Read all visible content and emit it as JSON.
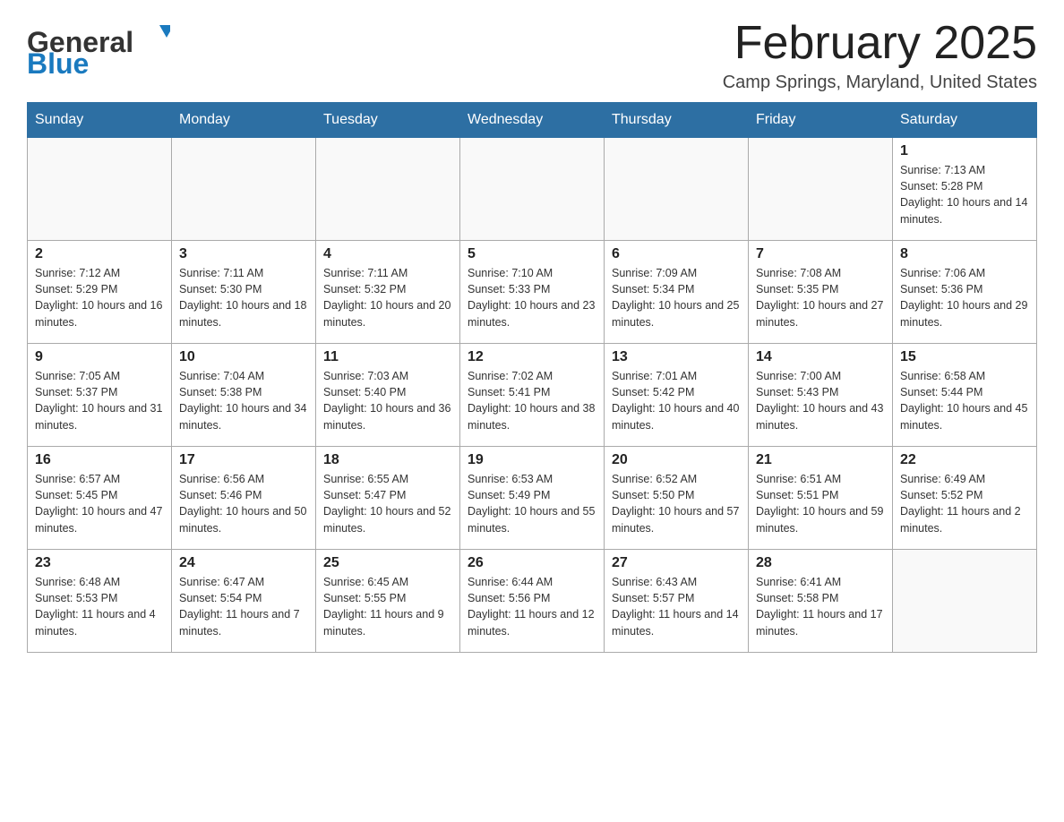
{
  "header": {
    "logo_general": "General",
    "logo_blue": "Blue",
    "month": "February 2025",
    "location": "Camp Springs, Maryland, United States"
  },
  "weekdays": [
    "Sunday",
    "Monday",
    "Tuesday",
    "Wednesday",
    "Thursday",
    "Friday",
    "Saturday"
  ],
  "weeks": [
    [
      {
        "day": "",
        "sunrise": "",
        "sunset": "",
        "daylight": ""
      },
      {
        "day": "",
        "sunrise": "",
        "sunset": "",
        "daylight": ""
      },
      {
        "day": "",
        "sunrise": "",
        "sunset": "",
        "daylight": ""
      },
      {
        "day": "",
        "sunrise": "",
        "sunset": "",
        "daylight": ""
      },
      {
        "day": "",
        "sunrise": "",
        "sunset": "",
        "daylight": ""
      },
      {
        "day": "",
        "sunrise": "",
        "sunset": "",
        "daylight": ""
      },
      {
        "day": "1",
        "sunrise": "Sunrise: 7:13 AM",
        "sunset": "Sunset: 5:28 PM",
        "daylight": "Daylight: 10 hours and 14 minutes."
      }
    ],
    [
      {
        "day": "2",
        "sunrise": "Sunrise: 7:12 AM",
        "sunset": "Sunset: 5:29 PM",
        "daylight": "Daylight: 10 hours and 16 minutes."
      },
      {
        "day": "3",
        "sunrise": "Sunrise: 7:11 AM",
        "sunset": "Sunset: 5:30 PM",
        "daylight": "Daylight: 10 hours and 18 minutes."
      },
      {
        "day": "4",
        "sunrise": "Sunrise: 7:11 AM",
        "sunset": "Sunset: 5:32 PM",
        "daylight": "Daylight: 10 hours and 20 minutes."
      },
      {
        "day": "5",
        "sunrise": "Sunrise: 7:10 AM",
        "sunset": "Sunset: 5:33 PM",
        "daylight": "Daylight: 10 hours and 23 minutes."
      },
      {
        "day": "6",
        "sunrise": "Sunrise: 7:09 AM",
        "sunset": "Sunset: 5:34 PM",
        "daylight": "Daylight: 10 hours and 25 minutes."
      },
      {
        "day": "7",
        "sunrise": "Sunrise: 7:08 AM",
        "sunset": "Sunset: 5:35 PM",
        "daylight": "Daylight: 10 hours and 27 minutes."
      },
      {
        "day": "8",
        "sunrise": "Sunrise: 7:06 AM",
        "sunset": "Sunset: 5:36 PM",
        "daylight": "Daylight: 10 hours and 29 minutes."
      }
    ],
    [
      {
        "day": "9",
        "sunrise": "Sunrise: 7:05 AM",
        "sunset": "Sunset: 5:37 PM",
        "daylight": "Daylight: 10 hours and 31 minutes."
      },
      {
        "day": "10",
        "sunrise": "Sunrise: 7:04 AM",
        "sunset": "Sunset: 5:38 PM",
        "daylight": "Daylight: 10 hours and 34 minutes."
      },
      {
        "day": "11",
        "sunrise": "Sunrise: 7:03 AM",
        "sunset": "Sunset: 5:40 PM",
        "daylight": "Daylight: 10 hours and 36 minutes."
      },
      {
        "day": "12",
        "sunrise": "Sunrise: 7:02 AM",
        "sunset": "Sunset: 5:41 PM",
        "daylight": "Daylight: 10 hours and 38 minutes."
      },
      {
        "day": "13",
        "sunrise": "Sunrise: 7:01 AM",
        "sunset": "Sunset: 5:42 PM",
        "daylight": "Daylight: 10 hours and 40 minutes."
      },
      {
        "day": "14",
        "sunrise": "Sunrise: 7:00 AM",
        "sunset": "Sunset: 5:43 PM",
        "daylight": "Daylight: 10 hours and 43 minutes."
      },
      {
        "day": "15",
        "sunrise": "Sunrise: 6:58 AM",
        "sunset": "Sunset: 5:44 PM",
        "daylight": "Daylight: 10 hours and 45 minutes."
      }
    ],
    [
      {
        "day": "16",
        "sunrise": "Sunrise: 6:57 AM",
        "sunset": "Sunset: 5:45 PM",
        "daylight": "Daylight: 10 hours and 47 minutes."
      },
      {
        "day": "17",
        "sunrise": "Sunrise: 6:56 AM",
        "sunset": "Sunset: 5:46 PM",
        "daylight": "Daylight: 10 hours and 50 minutes."
      },
      {
        "day": "18",
        "sunrise": "Sunrise: 6:55 AM",
        "sunset": "Sunset: 5:47 PM",
        "daylight": "Daylight: 10 hours and 52 minutes."
      },
      {
        "day": "19",
        "sunrise": "Sunrise: 6:53 AM",
        "sunset": "Sunset: 5:49 PM",
        "daylight": "Daylight: 10 hours and 55 minutes."
      },
      {
        "day": "20",
        "sunrise": "Sunrise: 6:52 AM",
        "sunset": "Sunset: 5:50 PM",
        "daylight": "Daylight: 10 hours and 57 minutes."
      },
      {
        "day": "21",
        "sunrise": "Sunrise: 6:51 AM",
        "sunset": "Sunset: 5:51 PM",
        "daylight": "Daylight: 10 hours and 59 minutes."
      },
      {
        "day": "22",
        "sunrise": "Sunrise: 6:49 AM",
        "sunset": "Sunset: 5:52 PM",
        "daylight": "Daylight: 11 hours and 2 minutes."
      }
    ],
    [
      {
        "day": "23",
        "sunrise": "Sunrise: 6:48 AM",
        "sunset": "Sunset: 5:53 PM",
        "daylight": "Daylight: 11 hours and 4 minutes."
      },
      {
        "day": "24",
        "sunrise": "Sunrise: 6:47 AM",
        "sunset": "Sunset: 5:54 PM",
        "daylight": "Daylight: 11 hours and 7 minutes."
      },
      {
        "day": "25",
        "sunrise": "Sunrise: 6:45 AM",
        "sunset": "Sunset: 5:55 PM",
        "daylight": "Daylight: 11 hours and 9 minutes."
      },
      {
        "day": "26",
        "sunrise": "Sunrise: 6:44 AM",
        "sunset": "Sunset: 5:56 PM",
        "daylight": "Daylight: 11 hours and 12 minutes."
      },
      {
        "day": "27",
        "sunrise": "Sunrise: 6:43 AM",
        "sunset": "Sunset: 5:57 PM",
        "daylight": "Daylight: 11 hours and 14 minutes."
      },
      {
        "day": "28",
        "sunrise": "Sunrise: 6:41 AM",
        "sunset": "Sunset: 5:58 PM",
        "daylight": "Daylight: 11 hours and 17 minutes."
      },
      {
        "day": "",
        "sunrise": "",
        "sunset": "",
        "daylight": ""
      }
    ]
  ]
}
